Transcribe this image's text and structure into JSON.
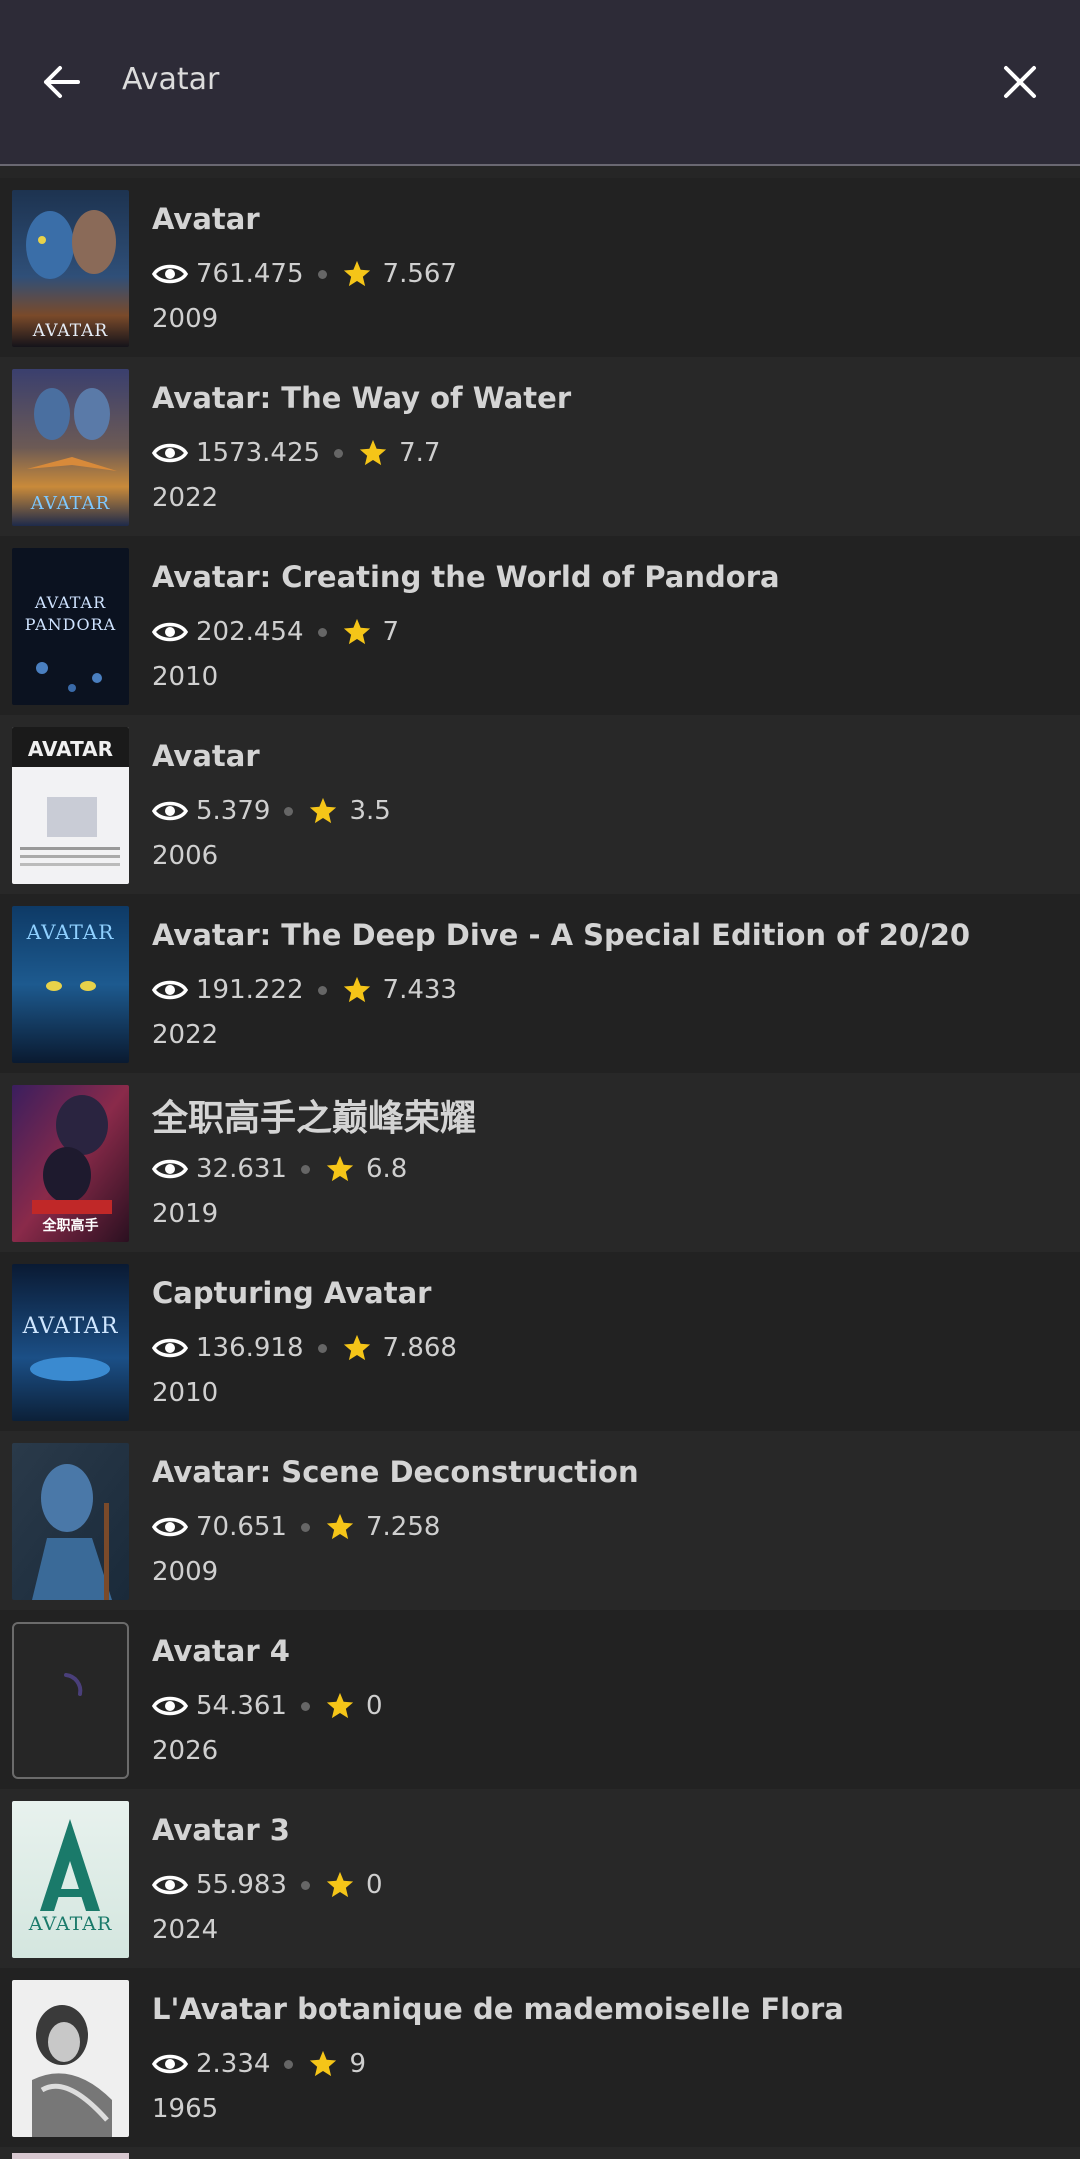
{
  "search": {
    "query": "Avatar"
  },
  "icons": {
    "back": "arrow-left-icon",
    "close": "close-icon",
    "views": "eye-icon",
    "rating": "star-icon"
  },
  "colors": {
    "star": "#f5c518",
    "topbar": "#2d2b37",
    "background": "#262626"
  },
  "results": [
    {
      "title": "Avatar",
      "views": "761.475",
      "rating": "7.567",
      "year": "2009",
      "poster_text": "AVATAR"
    },
    {
      "title": "Avatar: The Way of Water",
      "views": "1573.425",
      "rating": "7.7",
      "year": "2022",
      "poster_text": "AVATAR"
    },
    {
      "title": "Avatar: Creating the World of Pandora",
      "views": "202.454",
      "rating": "7",
      "year": "2010",
      "poster_text": "AVATAR PANDORA"
    },
    {
      "title": "Avatar",
      "views": "5.379",
      "rating": "3.5",
      "year": "2006",
      "poster_text": "AVATAR"
    },
    {
      "title": "Avatar: The Deep Dive - A Special Edition of 20/20",
      "views": "191.222",
      "rating": "7.433",
      "year": "2022",
      "poster_text": "AVATAR"
    },
    {
      "title": "全职高手之巅峰荣耀",
      "views": "32.631",
      "rating": "6.8",
      "year": "2019",
      "poster_text": "全职高手"
    },
    {
      "title": "Capturing Avatar",
      "views": "136.918",
      "rating": "7.868",
      "year": "2010",
      "poster_text": "AVATAR"
    },
    {
      "title": "Avatar: Scene Deconstruction",
      "views": "70.651",
      "rating": "7.258",
      "year": "2009",
      "poster_text": ""
    },
    {
      "title": "Avatar 4",
      "views": "54.361",
      "rating": "0",
      "year": "2026",
      "poster_text": ""
    },
    {
      "title": "Avatar 3",
      "views": "55.983",
      "rating": "0",
      "year": "2024",
      "poster_text": "AVATAR"
    },
    {
      "title": "L'Avatar botanique de mademoiselle Flora",
      "views": "2.334",
      "rating": "9",
      "year": "1965",
      "poster_text": ""
    }
  ]
}
